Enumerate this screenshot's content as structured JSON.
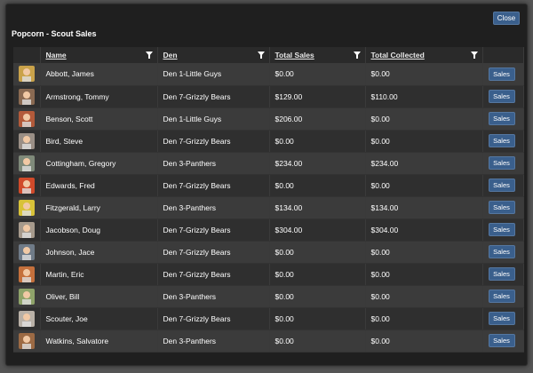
{
  "window": {
    "close_label": "Close",
    "title": "Popcorn - Scout Sales"
  },
  "table": {
    "headers": {
      "name": "Name",
      "den": "Den",
      "total_sales": "Total Sales",
      "total_collected": "Total Collected"
    },
    "sales_button_label": "Sales",
    "rows": [
      {
        "name": "Abbott, James",
        "den": "Den 1-Little Guys",
        "total_sales": "$0.00",
        "total_collected": "$0.00",
        "avatar_color": "#c9a24a"
      },
      {
        "name": "Armstrong, Tommy",
        "den": "Den 7-Grizzly Bears",
        "total_sales": "$129.00",
        "total_collected": "$110.00",
        "avatar_color": "#8a6a52"
      },
      {
        "name": "Benson, Scott",
        "den": "Den 1-Little Guys",
        "total_sales": "$206.00",
        "total_collected": "$0.00",
        "avatar_color": "#b35a3a"
      },
      {
        "name": "Bird, Steve",
        "den": "Den 7-Grizzly Bears",
        "total_sales": "$0.00",
        "total_collected": "$0.00",
        "avatar_color": "#9a8f86"
      },
      {
        "name": "Cottingham, Gregory",
        "den": "Den 3-Panthers",
        "total_sales": "$234.00",
        "total_collected": "$234.00",
        "avatar_color": "#7f8a7a"
      },
      {
        "name": "Edwards, Fred",
        "den": "Den 7-Grizzly Bears",
        "total_sales": "$0.00",
        "total_collected": "$0.00",
        "avatar_color": "#d04a2a"
      },
      {
        "name": "Fitzgerald, Larry",
        "den": "Den 3-Panthers",
        "total_sales": "$134.00",
        "total_collected": "$134.00",
        "avatar_color": "#d8c238"
      },
      {
        "name": "Jacobson, Doug",
        "den": "Den 7-Grizzly Bears",
        "total_sales": "$304.00",
        "total_collected": "$304.00",
        "avatar_color": "#a69a8c"
      },
      {
        "name": "Johnson, Jace",
        "den": "Den 7-Grizzly Bears",
        "total_sales": "$0.00",
        "total_collected": "$0.00",
        "avatar_color": "#6f7b88"
      },
      {
        "name": "Martin, Eric",
        "den": "Den 7-Grizzly Bears",
        "total_sales": "$0.00",
        "total_collected": "$0.00",
        "avatar_color": "#c4703c"
      },
      {
        "name": "Oliver, Bill",
        "den": "Den 3-Panthers",
        "total_sales": "$0.00",
        "total_collected": "$0.00",
        "avatar_color": "#8fa36a"
      },
      {
        "name": "Scouter, Joe",
        "den": "Den 7-Grizzly Bears",
        "total_sales": "$0.00",
        "total_collected": "$0.00",
        "avatar_color": "#b8b0a6"
      },
      {
        "name": "Watkins, Salvatore",
        "den": "Den 3-Panthers",
        "total_sales": "$0.00",
        "total_collected": "$0.00",
        "avatar_color": "#9c6a44"
      }
    ]
  },
  "colors": {
    "button_bg": "#3a5f8c",
    "row_odd": "#3b3b3b",
    "row_even": "#2f2f2f",
    "dialog_bg": "#1f1f1f"
  }
}
